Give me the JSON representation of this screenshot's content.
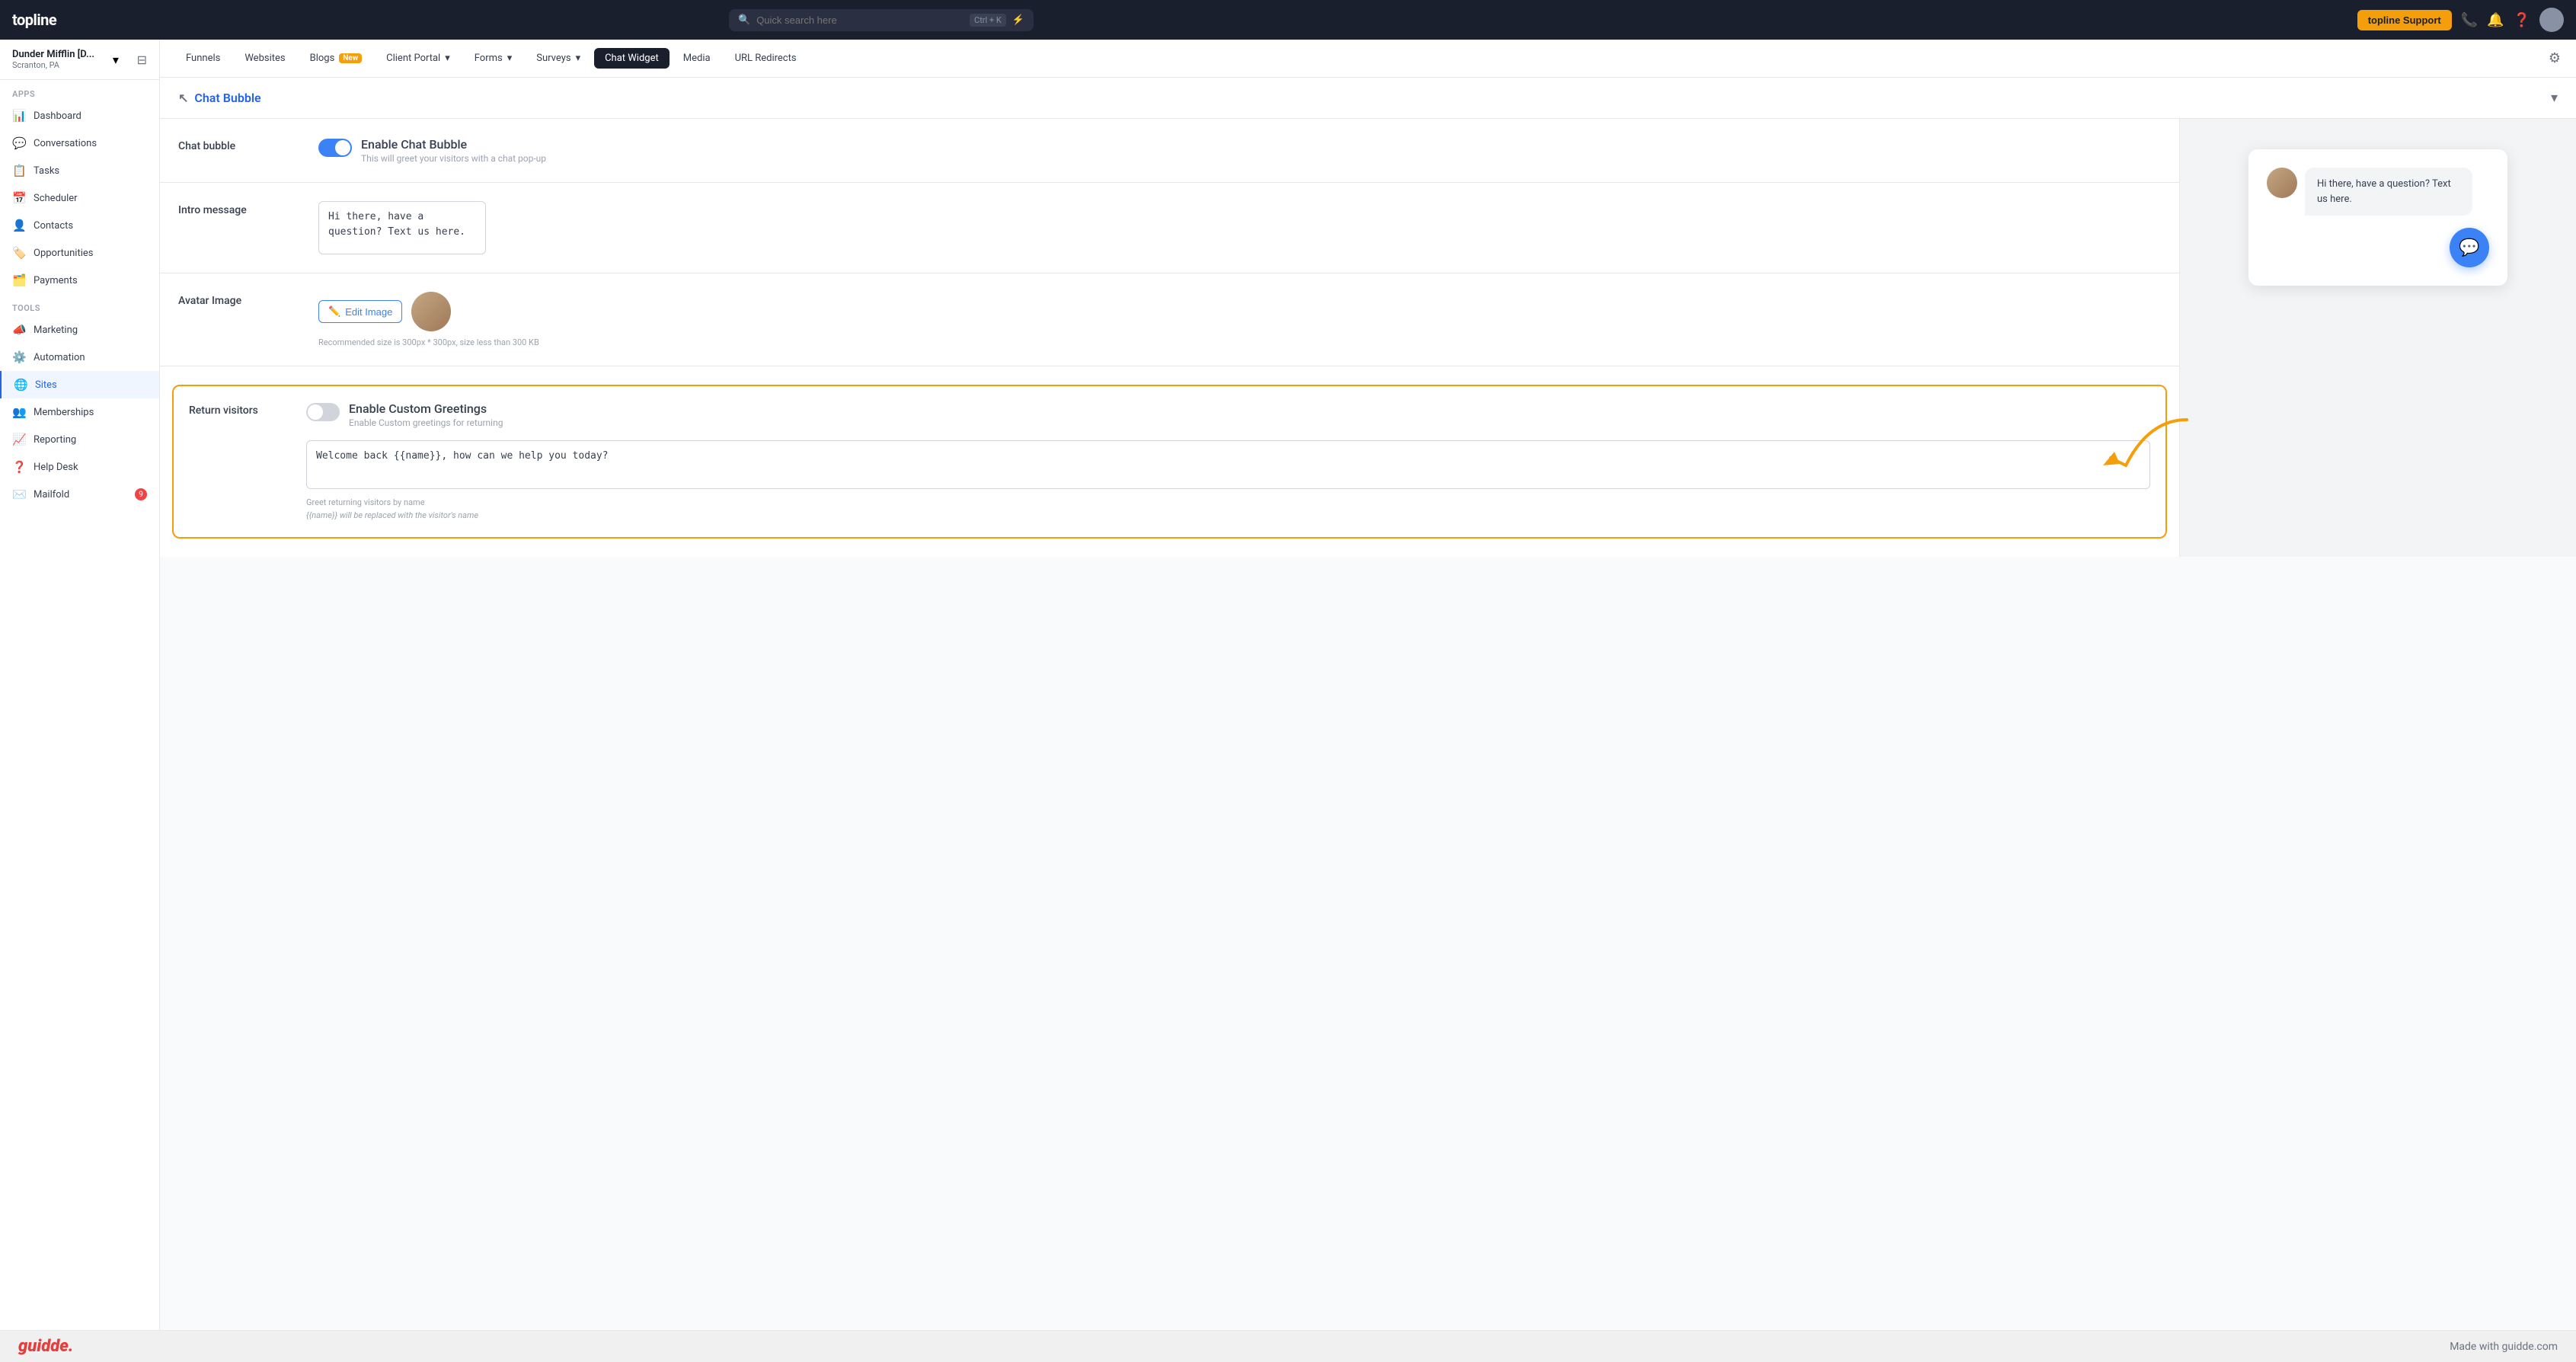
{
  "topnav": {
    "logo": "topline",
    "search_placeholder": "Quick search here",
    "search_shortcut": "Ctrl + K",
    "support_label": "topline Support",
    "lightning_icon": "⚡"
  },
  "sidebar": {
    "workspace": "Dunder Mifflin [D...",
    "workspace_location": "Scranton, PA",
    "sections": {
      "apps_label": "Apps",
      "tools_label": "Tools"
    },
    "apps_items": [
      {
        "label": "Dashboard",
        "icon": "📊"
      },
      {
        "label": "Conversations",
        "icon": "💬"
      },
      {
        "label": "Tasks",
        "icon": "📋"
      },
      {
        "label": "Scheduler",
        "icon": "📅"
      },
      {
        "label": "Contacts",
        "icon": "👤"
      },
      {
        "label": "Opportunities",
        "icon": "🏷️"
      },
      {
        "label": "Payments",
        "icon": "🗂️"
      }
    ],
    "tools_items": [
      {
        "label": "Marketing",
        "icon": "📣"
      },
      {
        "label": "Automation",
        "icon": "⚙️"
      },
      {
        "label": "Sites",
        "icon": "🌐",
        "active": true
      },
      {
        "label": "Memberships",
        "icon": "👥"
      },
      {
        "label": "Reporting",
        "icon": "📈"
      },
      {
        "label": "Help Desk",
        "icon": "❓"
      },
      {
        "label": "Mailfold",
        "icon": "✉️",
        "badge": "9"
      }
    ]
  },
  "second_nav": {
    "tabs": [
      {
        "label": "Funnels",
        "active": false
      },
      {
        "label": "Websites",
        "active": false
      },
      {
        "label": "Blogs",
        "active": false,
        "badge": "New"
      },
      {
        "label": "Client Portal",
        "active": false,
        "has_dropdown": true
      },
      {
        "label": "Forms",
        "active": false,
        "has_dropdown": true
      },
      {
        "label": "Surveys",
        "active": false,
        "has_dropdown": true
      },
      {
        "label": "Chat Widget",
        "active": true
      },
      {
        "label": "Media",
        "active": false
      },
      {
        "label": "URL Redirects",
        "active": false
      }
    ]
  },
  "main": {
    "section_title": "Chat Bubble",
    "settings": {
      "chat_bubble": {
        "label": "Chat bubble",
        "toggle_label": "Enable Chat Bubble",
        "toggle_sub": "This will greet your visitors with a chat pop-up",
        "toggle_on": true
      },
      "intro_message": {
        "label": "Intro message",
        "value": "Hi there, have a question? Text us here."
      },
      "avatar_image": {
        "label": "Avatar Image",
        "edit_label": "Edit Image",
        "hint": "Recommended size is 300px * 300px, size less than 300 KB"
      },
      "return_visitors": {
        "label": "Return visitors",
        "toggle_label": "Enable Custom Greetings",
        "toggle_sub": "Enable Custom greetings for returning",
        "toggle_on": true,
        "textarea_value": "Welcome back {{name}}, how can we help you today?",
        "helper_line1": "Greet returning visitors by name",
        "helper_line2": "{{name}} will be replaced with the visitor's name"
      }
    },
    "preview": {
      "chat_message": "Hi there, have a question? Text us here.",
      "fab_icon": "💬"
    }
  },
  "bottom_bar": {
    "logo": "guidde.",
    "tagline": "Made with guidde.com"
  }
}
